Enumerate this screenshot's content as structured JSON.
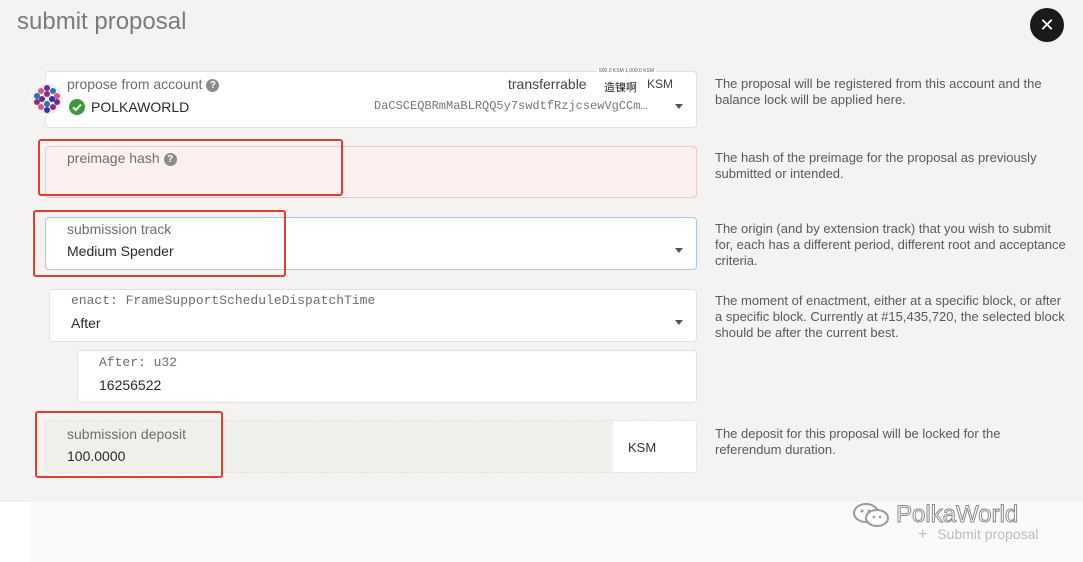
{
  "title": "submit proposal",
  "close_glyph": "✕",
  "account": {
    "label": "propose from account",
    "help_glyph": "?",
    "transferrable_label": "transferrable",
    "balance_tiny": "500.0 KSM 1,000.0 KSM",
    "balance_value": "造镍啊",
    "unit": "KSM",
    "name": "POLKAWORLD",
    "address": "DaCSCEQBRmMaBLRQQ5y7swdtfRzjcsewVgCCm…",
    "help_text": "The proposal will be registered from this account and the balance lock will be applied here."
  },
  "preimage": {
    "label": "preimage hash",
    "help_glyph": "?",
    "value": "",
    "help_text": "The hash of the preimage for the proposal as previously submitted or intended."
  },
  "track": {
    "label": "submission track",
    "value": "Medium Spender",
    "help_text": "The origin (and by extension track) that you wish to submit for, each has a different period, different root and acceptance criteria."
  },
  "enact": {
    "label": "enact: FrameSupportScheduleDispatchTime",
    "value": "After",
    "help_text": "The moment of enactment, either at a specific block, or after a specific block. Currently at #15,435,720, the selected block should be after the current best."
  },
  "after": {
    "label": "After: u32",
    "value": "16256522"
  },
  "deposit": {
    "label": "submission deposit",
    "value": "100.0000",
    "unit": "KSM",
    "help_text": "The deposit for this proposal will be locked for the referendum duration."
  },
  "footer": {
    "submit_label": "Submit proposal",
    "plus_glyph": "+",
    "watermark": "PolkaWorld"
  }
}
